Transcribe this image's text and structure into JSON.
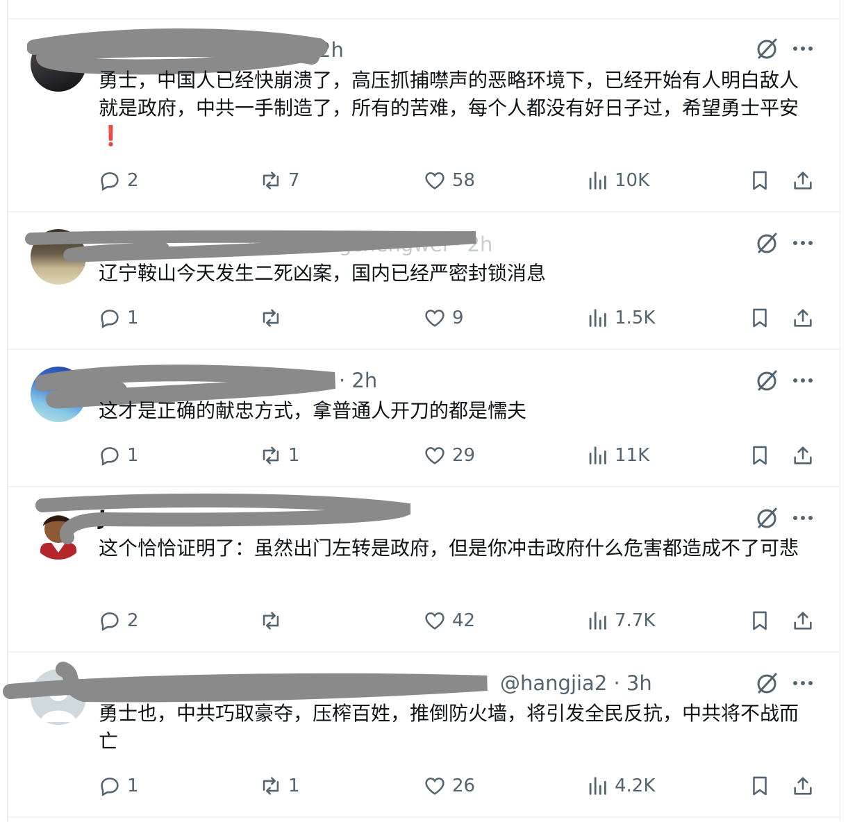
{
  "replies": [
    {
      "header_visible": "2h",
      "text": "勇士，中国人已经快崩溃了，高压抓捕噤声的恶略环境下，已经开始有人明白敌人就是政府，中共一手制造了，所有的苦难，每个人都没有好日子过，希望勇士平安",
      "emoji": "❗",
      "reply_count": "2",
      "repost_count": "7",
      "like_count": "58",
      "view_count": "10K"
    },
    {
      "header_visible": "@woxiangchengwei · 2h",
      "text": "辽宁鞍山今天发生二死凶案，国内已经严密封锁消息",
      "reply_count": "1",
      "repost_count": "",
      "like_count": "9",
      "view_count": "1.5K"
    },
    {
      "header_visible": "· 2h",
      "text": "这才是正确的献忠方式，拿普通人开刀的都是懦夫",
      "reply_count": "1",
      "repost_count": "1",
      "like_count": "29",
      "view_count": "11K"
    },
    {
      "header_visible": "Jonesun",
      "text": "这个恰恰证明了：虽然出门左转是政府，但是你冲击政府什么危害都造成不了可悲",
      "reply_count": "2",
      "repost_count": "",
      "like_count": "42",
      "view_count": "7.7K"
    },
    {
      "header_visible": "@hangjia2 · 3h",
      "text": "勇士也，中共巧取豪夺，压榨百姓，推倒防火墙，将引发全民反抗，中共将不战而亡",
      "reply_count": "1",
      "repost_count": "1",
      "like_count": "26",
      "view_count": "4.2K"
    }
  ],
  "icons": {
    "reply": "reply-icon",
    "repost": "repost-icon",
    "like": "heart-icon",
    "views": "views-icon",
    "bookmark": "bookmark-icon",
    "share": "share-icon",
    "grok": "grok-icon",
    "more": "more-icon"
  },
  "colors": {
    "text": "#0f1419",
    "secondary": "#536471",
    "divider": "#eff3f4",
    "redaction": "#8a8a8a"
  }
}
